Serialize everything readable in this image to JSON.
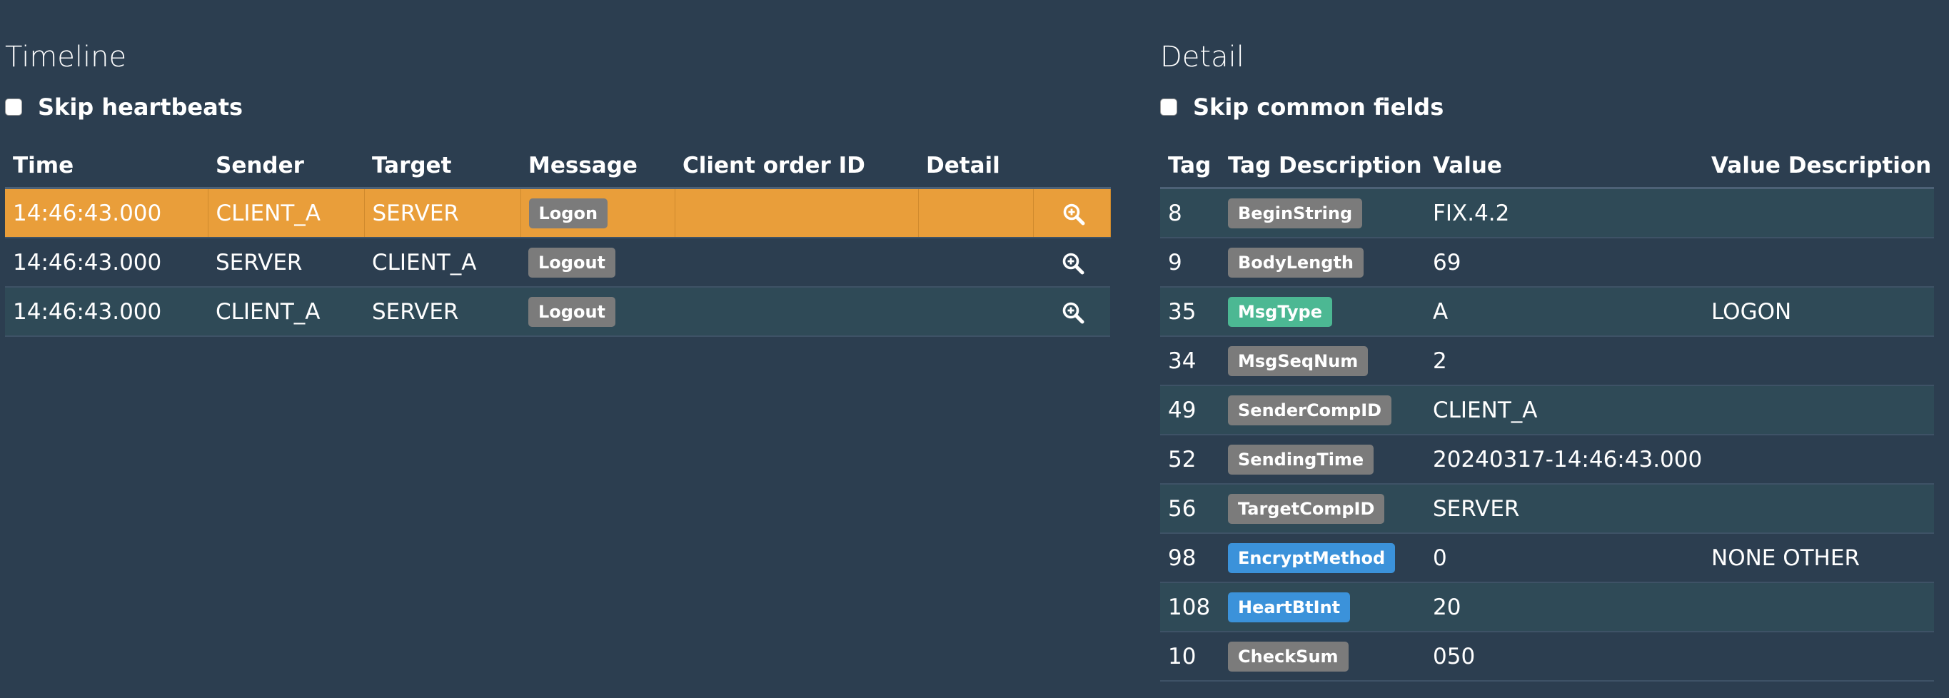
{
  "timeline": {
    "title": "Timeline",
    "skip_label": "Skip heartbeats",
    "columns": [
      "Time",
      "Sender",
      "Target",
      "Message",
      "Client order ID",
      "Detail"
    ],
    "rows": [
      {
        "time": "14:46:43.000",
        "sender": "CLIENT_A",
        "target": "SERVER",
        "message": "Logon",
        "client_order_id": "",
        "selected": true
      },
      {
        "time": "14:46:43.000",
        "sender": "SERVER",
        "target": "CLIENT_A",
        "message": "Logout",
        "client_order_id": "",
        "selected": false
      },
      {
        "time": "14:46:43.000",
        "sender": "CLIENT_A",
        "target": "SERVER",
        "message": "Logout",
        "client_order_id": "",
        "selected": false
      }
    ],
    "detail_icon": "zoom-in-icon"
  },
  "detail": {
    "title": "Detail",
    "skip_label": "Skip common fields",
    "columns": [
      "Tag",
      "Tag Description",
      "Value",
      "Value Description"
    ],
    "rows": [
      {
        "tag": "8",
        "desc": "BeginString",
        "value": "FIX.4.2",
        "value_desc": "",
        "badge_color": "#7b7b7b"
      },
      {
        "tag": "9",
        "desc": "BodyLength",
        "value": "69",
        "value_desc": "",
        "badge_color": "#7b7b7b"
      },
      {
        "tag": "35",
        "desc": "MsgType",
        "value": "A",
        "value_desc": "LOGON",
        "badge_color": "#4cb893"
      },
      {
        "tag": "34",
        "desc": "MsgSeqNum",
        "value": "2",
        "value_desc": "",
        "badge_color": "#7b7b7b"
      },
      {
        "tag": "49",
        "desc": "SenderCompID",
        "value": "CLIENT_A",
        "value_desc": "",
        "badge_color": "#7b7b7b"
      },
      {
        "tag": "52",
        "desc": "SendingTime",
        "value": "20240317-14:46:43.000",
        "value_desc": "",
        "badge_color": "#7b7b7b"
      },
      {
        "tag": "56",
        "desc": "TargetCompID",
        "value": "SERVER",
        "value_desc": "",
        "badge_color": "#7b7b7b"
      },
      {
        "tag": "98",
        "desc": "EncryptMethod",
        "value": "0",
        "value_desc": "NONE OTHER",
        "badge_color": "#3b92da"
      },
      {
        "tag": "108",
        "desc": "HeartBtInt",
        "value": "20",
        "value_desc": "",
        "badge_color": "#3b92da"
      },
      {
        "tag": "10",
        "desc": "CheckSum",
        "value": "050",
        "value_desc": "",
        "badge_color": "#7b7b7b"
      }
    ]
  },
  "colors": {
    "background": "#2c3e50",
    "selected_row": "#e99e3a",
    "badge_gray": "#7b7b7b",
    "badge_green": "#4cb893",
    "badge_blue": "#3b92da"
  }
}
